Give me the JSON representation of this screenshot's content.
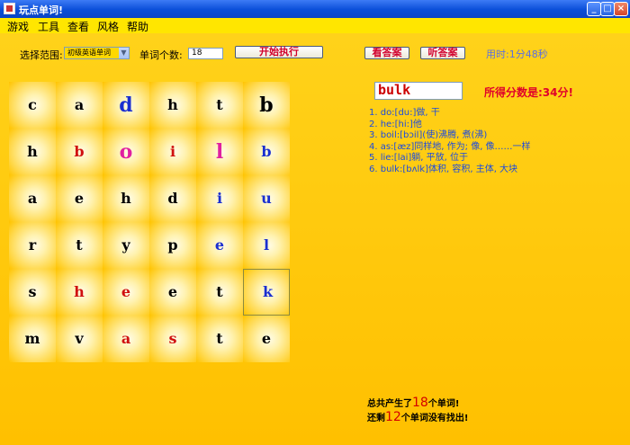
{
  "window": {
    "title": "玩点单词!",
    "min": "_",
    "max": "□",
    "close": "×"
  },
  "menu": [
    "游戏",
    "工具",
    "查看",
    "风格",
    "帮助"
  ],
  "controls": {
    "range_label": "选择范围:",
    "range_value": "初级英语单词",
    "count_label": "单词个数:",
    "count_value": "18",
    "start_button": "开始执行",
    "view_answer": "看答案",
    "hear_answer": "听答案",
    "timer": "用时:1分48秒"
  },
  "grid": [
    [
      {
        "ch": "c",
        "color": "#000000"
      },
      {
        "ch": "a",
        "color": "#000000"
      },
      {
        "ch": "d",
        "color": "#1a2fd0",
        "big": true
      },
      {
        "ch": "h",
        "color": "#000000"
      },
      {
        "ch": "t",
        "color": "#000000"
      },
      {
        "ch": "b",
        "color": "#000000",
        "big": true
      }
    ],
    [
      {
        "ch": "h",
        "color": "#000000"
      },
      {
        "ch": "b",
        "color": "#d01010"
      },
      {
        "ch": "o",
        "color": "#e020a0",
        "big": true
      },
      {
        "ch": "i",
        "color": "#d01010"
      },
      {
        "ch": "l",
        "color": "#e020a0",
        "big": true
      },
      {
        "ch": "b",
        "color": "#1a2fd0"
      }
    ],
    [
      {
        "ch": "a",
        "color": "#000000"
      },
      {
        "ch": "e",
        "color": "#000000"
      },
      {
        "ch": "h",
        "color": "#000000"
      },
      {
        "ch": "d",
        "color": "#000000"
      },
      {
        "ch": "i",
        "color": "#1a2fd0"
      },
      {
        "ch": "u",
        "color": "#1a2fd0"
      }
    ],
    [
      {
        "ch": "r",
        "color": "#000000"
      },
      {
        "ch": "t",
        "color": "#000000"
      },
      {
        "ch": "y",
        "color": "#000000"
      },
      {
        "ch": "p",
        "color": "#000000"
      },
      {
        "ch": "e",
        "color": "#1a2fd0"
      },
      {
        "ch": "l",
        "color": "#1a2fd0"
      }
    ],
    [
      {
        "ch": "s",
        "color": "#000000"
      },
      {
        "ch": "h",
        "color": "#d01010"
      },
      {
        "ch": "e",
        "color": "#d01010"
      },
      {
        "ch": "e",
        "color": "#000000"
      },
      {
        "ch": "t",
        "color": "#000000"
      },
      {
        "ch": "k",
        "color": "#1a2fd0",
        "selected": true
      }
    ],
    [
      {
        "ch": "m",
        "color": "#000000"
      },
      {
        "ch": "v",
        "color": "#000000"
      },
      {
        "ch": "a",
        "color": "#d01010"
      },
      {
        "ch": "s",
        "color": "#d01010"
      },
      {
        "ch": "t",
        "color": "#000000"
      },
      {
        "ch": "e",
        "color": "#000000"
      }
    ]
  ],
  "current_word": "bulk",
  "score_text": "所得分数是:34分!",
  "definitions": [
    "1. do:[du:]做, 干",
    "2. he:[hi:]他",
    "3. boil:[bɔil](使)沸腾, 煮(沸)",
    "4. as:[æz]同样地, 作为; 像, 像……一样",
    "5. lie:[lai]躺, 平放, 位于",
    "6. bulk:[bʌlk]体积, 容积, 主体, 大块"
  ],
  "summary": {
    "line1_pre": "总共产生了",
    "line1_num": "18",
    "line1_post": "个单词!",
    "line2_pre": "还剩",
    "line2_num": "12",
    "line2_post": "个单词没有找出!"
  },
  "colors": {
    "accent": "#d1002c",
    "panel": "#ffcc00",
    "link_blue": "#1a4ae0"
  }
}
